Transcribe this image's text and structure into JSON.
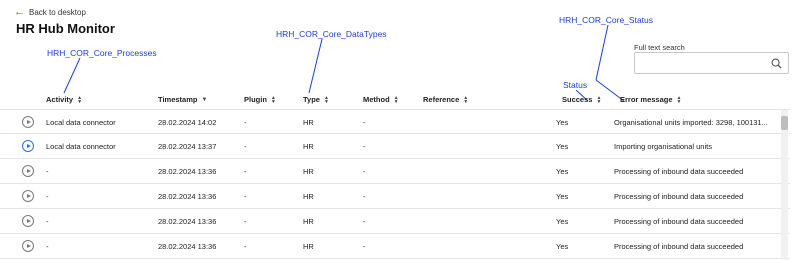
{
  "nav": {
    "back_label": "Back to desktop"
  },
  "page": {
    "title": "HR Hub Monitor"
  },
  "annotations": {
    "processes": "HRH_COR_Core_Processes",
    "datatypes": "HRH_COR_Core_DataTypes",
    "status_entity": "HRH_COR_Core_Status",
    "status": "Status"
  },
  "search": {
    "label": "Full text search",
    "value": "",
    "icon": "search-icon"
  },
  "columns": {
    "activity": "Activity",
    "timestamp": "Timestamp",
    "plugin": "Plugin",
    "type": "Type",
    "method": "Method",
    "reference": "Reference",
    "success": "Success",
    "error_message": "Error message"
  },
  "rows": [
    {
      "activity": "Local data connector",
      "timestamp": "28.02.2024 14:02",
      "plugin": "-",
      "type": "HR",
      "method": "-",
      "success": "Yes",
      "message": "Organisational units imported: 3298, 100131...",
      "active": false
    },
    {
      "activity": "Local data connector",
      "timestamp": "28.02.2024 13:37",
      "plugin": "-",
      "type": "HR",
      "method": "-",
      "success": "Yes",
      "message": "Importing organisational units",
      "active": true
    },
    {
      "activity": "-",
      "timestamp": "28.02.2024 13:36",
      "plugin": "-",
      "type": "HR",
      "method": "-",
      "success": "Yes",
      "message": "Processing of inbound data succeeded",
      "active": false
    },
    {
      "activity": "-",
      "timestamp": "28.02.2024 13:36",
      "plugin": "-",
      "type": "HR",
      "method": "-",
      "success": "Yes",
      "message": "Processing of inbound data succeeded",
      "active": false
    },
    {
      "activity": "-",
      "timestamp": "28.02.2024 13:36",
      "plugin": "-",
      "type": "HR",
      "method": "-",
      "success": "Yes",
      "message": "Processing of inbound data succeeded",
      "active": false
    },
    {
      "activity": "-",
      "timestamp": "28.02.2024 13:36",
      "plugin": "-",
      "type": "HR",
      "method": "-",
      "success": "Yes",
      "message": "Processing of inbound data succeeded",
      "active": false
    }
  ],
  "colors": {
    "accent": "#2f6fd6",
    "annotation": "#1a3fd6",
    "back_arrow": "#c0392b"
  }
}
